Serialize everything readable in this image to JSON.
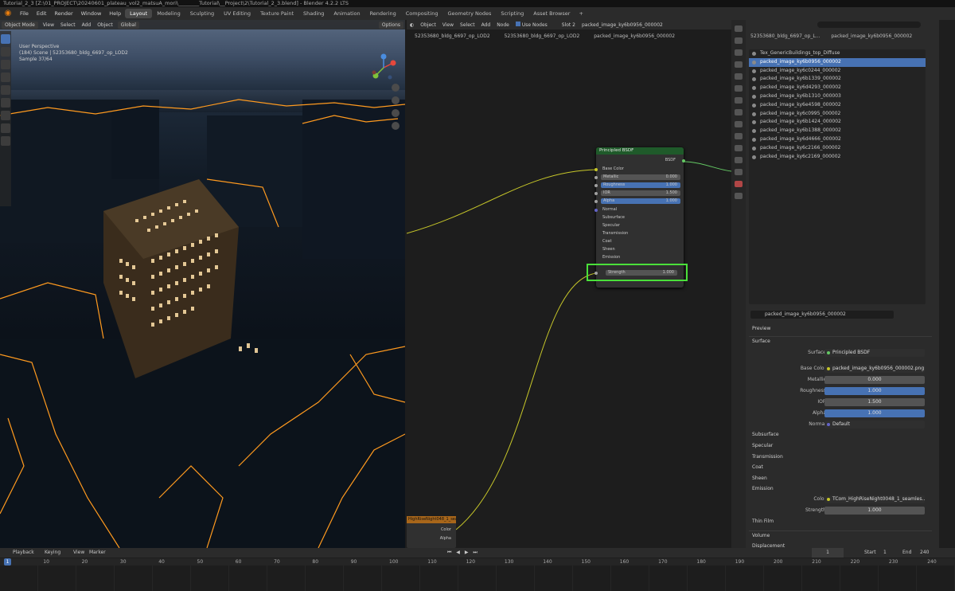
{
  "window": {
    "title": "Tutorial_2_3 [Z:\\01_PROJECT\\20240601_plateau_vol2_matsuA_mori\\________Tutorial\\__Project\\2\\Tutorial_2_3.blend] - Blender 4.2.2 LTS"
  },
  "menu": [
    "File",
    "Edit",
    "Render",
    "Window",
    "Help"
  ],
  "workspaces": {
    "tabs": [
      "Layout",
      "Modeling",
      "Sculpting",
      "UV Editing",
      "Texture Paint",
      "Shading",
      "Animation",
      "Rendering",
      "Compositing",
      "Geometry Nodes",
      "Scripting",
      "Asset Browser"
    ],
    "active": "Layout",
    "add": "+"
  },
  "viewport": {
    "mode": "Object Mode",
    "menus": [
      "View",
      "Select",
      "Add",
      "Object"
    ],
    "transform": "Global",
    "options": "Options",
    "info_line1": "User Perspective",
    "info_line2": "(184) Scene | 52353680_bldg_6697_op_LOD2",
    "info_line3": "Sample 37/64"
  },
  "node_editor": {
    "object_label": "Object",
    "menus": [
      "View",
      "Select",
      "Add",
      "Node"
    ],
    "use_nodes": "Use Nodes",
    "slot": "Slot 2",
    "material": "packed_image_ky6b0956_000002",
    "breadcrumb": [
      "52353680_bldg_6697_op_LOD2",
      "52353680_bldg_6697_op_LOD2",
      "packed_image_ky6b0956_000002"
    ],
    "bsdf_node": {
      "title": "Principled BSDF",
      "output": "BSDF",
      "base_color": "Base Color",
      "fields": [
        {
          "label": "Metallic",
          "value": "0.000"
        },
        {
          "label": "Roughness",
          "value": "1.000"
        },
        {
          "label": "IOR",
          "value": "1.500"
        },
        {
          "label": "Alpha",
          "value": "1.000"
        }
      ],
      "normal": "Normal",
      "panels": [
        "Subsurface",
        "Specular",
        "Transmission",
        "Coat",
        "Sheen"
      ],
      "emission": "Emission",
      "strength_label": "Strength",
      "strength_value": "1.000"
    },
    "texture_node": {
      "title": "HighRiseNight048_1_seamles",
      "out_color": "Color",
      "out_alpha": "Alpha"
    }
  },
  "properties": {
    "search_placeholder": "",
    "breadcrumb_obj": "52353680_bldg_6697_op_L...",
    "breadcrumb_mat": "packed_image_ky6b0956_000002",
    "images": [
      "Tex_GenericBuildings_top_Diffuse",
      "packed_image_ky6b0956_000002",
      "packed_image_ky6c0244_000002",
      "packed_image_ky6b1339_000002",
      "packed_image_ky6d4293_000002",
      "packed_image_ky6b1310_000003",
      "packed_image_ky6e4598_000002",
      "packed_image_ky6c0995_000002",
      "packed_image_ky6b1424_000002",
      "packed_image_ky6b1388_000002",
      "packed_image_ky6d4666_000002",
      "packed_image_ky6c2166_000002",
      "packed_image_ky6c2169_000002"
    ],
    "active_index": 1,
    "material_name": "packed_image_ky6b0956_000002",
    "preview": "Preview",
    "surface_header": "Surface",
    "surface_label": "Surface",
    "surface_value": "Principled BSDF",
    "base_color_label": "Base Color",
    "base_color_value": "packed_image_ky6b0956_000002.png",
    "metallic_label": "Metallic",
    "metallic_value": "0.000",
    "roughness_label": "Roughness",
    "roughness_value": "1.000",
    "ior_label": "IOR",
    "ior_value": "1.500",
    "alpha_label": "Alpha",
    "alpha_value": "1.000",
    "normal_label": "Normal",
    "normal_value": "Default",
    "subpanels": [
      "Subsurface",
      "Specular",
      "Transmission",
      "Coat",
      "Sheen"
    ],
    "emission_header": "Emission",
    "color_label": "Color",
    "color_value": "TCom_HighRiseNight0048_1_seamles...",
    "strength_label": "Strength",
    "strength_value": "1.000",
    "thin_film": "Thin Film",
    "volume": "Volume",
    "displacement": "Displacement"
  },
  "timeline": {
    "menus": [
      "Playback",
      "Keying",
      "View",
      "Marker"
    ],
    "current_frame": "1",
    "start_label": "Start",
    "start_value": "1",
    "end_label": "End",
    "end_value": "240",
    "ruler": [
      "1",
      "10",
      "20",
      "30",
      "40",
      "50",
      "60",
      "70",
      "80",
      "90",
      "100",
      "110",
      "120",
      "130",
      "140",
      "150",
      "160",
      "170",
      "180",
      "190",
      "200",
      "210",
      "220",
      "230",
      "240"
    ]
  },
  "colors": {
    "accent": "#4772b3",
    "selection_outline": "#ff9a1f",
    "highlight_box": "#4ae03a",
    "node_header": "#1f5a2a"
  }
}
